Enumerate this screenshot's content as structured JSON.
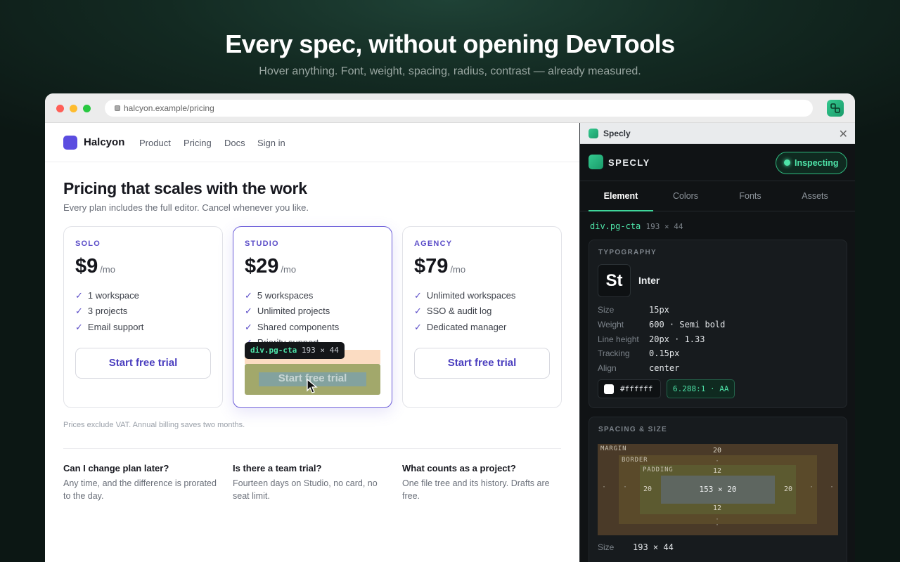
{
  "hero": {
    "title": "Every spec, without opening DevTools",
    "subtitle": "Hover anything. Font, weight, spacing, radius, contrast — already measured."
  },
  "browser": {
    "url": "halcyon.example/pricing",
    "lock_icon": "lock-icon",
    "traffic_lights": [
      "#ff5f57",
      "#febc2e",
      "#28c840"
    ]
  },
  "site": {
    "brand": "Halcyon",
    "nav": [
      "Product",
      "Pricing",
      "Docs",
      "Sign in"
    ],
    "heading": "Pricing that scales with the work",
    "lead": "Every plan includes the full editor. Cancel whenever you like.",
    "plans": [
      {
        "tier": "SOLO",
        "price": "$9",
        "period": "/mo",
        "features": [
          "1 workspace",
          "3 projects",
          "Email support"
        ],
        "cta": "Start free trial"
      },
      {
        "tier": "STUDIO",
        "price": "$29",
        "period": "/mo",
        "features": [
          "5 workspaces",
          "Unlimited projects",
          "Shared components",
          "Priority support"
        ],
        "cta": "Start free trial"
      },
      {
        "tier": "AGENCY",
        "price": "$79",
        "period": "/mo",
        "features": [
          "Unlimited workspaces",
          "SSO & audit log",
          "Dedicated manager"
        ],
        "cta": "Start free trial"
      }
    ],
    "note": "Prices exclude VAT. Annual billing saves two months.",
    "faq": [
      {
        "q": "Can I change plan later?",
        "a": "Any time, and the difference is prorated to the day."
      },
      {
        "q": "Is there a team trial?",
        "a": "Fourteen days on Studio, no card, no seat limit."
      },
      {
        "q": "What counts as a project?",
        "a": "One file tree and its history. Drafts are free."
      }
    ],
    "check_glyph": "✓"
  },
  "overlay": {
    "selector": "div.pg-cta",
    "size": "193 × 44",
    "text": "Start free trial"
  },
  "panel": {
    "header_title": "Specly",
    "brand": "SPECLY",
    "status": "Inspecting",
    "tabs": [
      "Element",
      "Colors",
      "Fonts",
      "Assets"
    ],
    "active_tab": "Element",
    "selector": "div.pg-cta",
    "selector_size": "193 × 44",
    "typography": {
      "title": "TYPOGRAPHY",
      "sample": "St",
      "font": "Inter",
      "rows": [
        {
          "k": "Size",
          "v": "15px"
        },
        {
          "k": "Weight",
          "v": "600 · Semi bold"
        },
        {
          "k": "Line height",
          "v": "20px · 1.33"
        },
        {
          "k": "Tracking",
          "v": "0.15px"
        },
        {
          "k": "Align",
          "v": "center"
        }
      ],
      "color": "#ffffff",
      "contrast": "6.288:1 · AA"
    },
    "spacing": {
      "title": "SPACING & SIZE",
      "margin_label": "MARGIN",
      "border_label": "BORDER",
      "padding_label": "PADDING",
      "margin_top": "20",
      "border_top": "·",
      "padding_top": "12",
      "padding_left": "20",
      "padding_right": "20",
      "padding_bottom": "12",
      "border_bottom": "·",
      "margin_bottom": "·",
      "margin_left": "·",
      "margin_right": "·",
      "border_left": "·",
      "border_right": "·",
      "content": "153 × 20",
      "size_label": "Size",
      "size_value": "193 × 44"
    },
    "accent": "#4ee3a8"
  }
}
